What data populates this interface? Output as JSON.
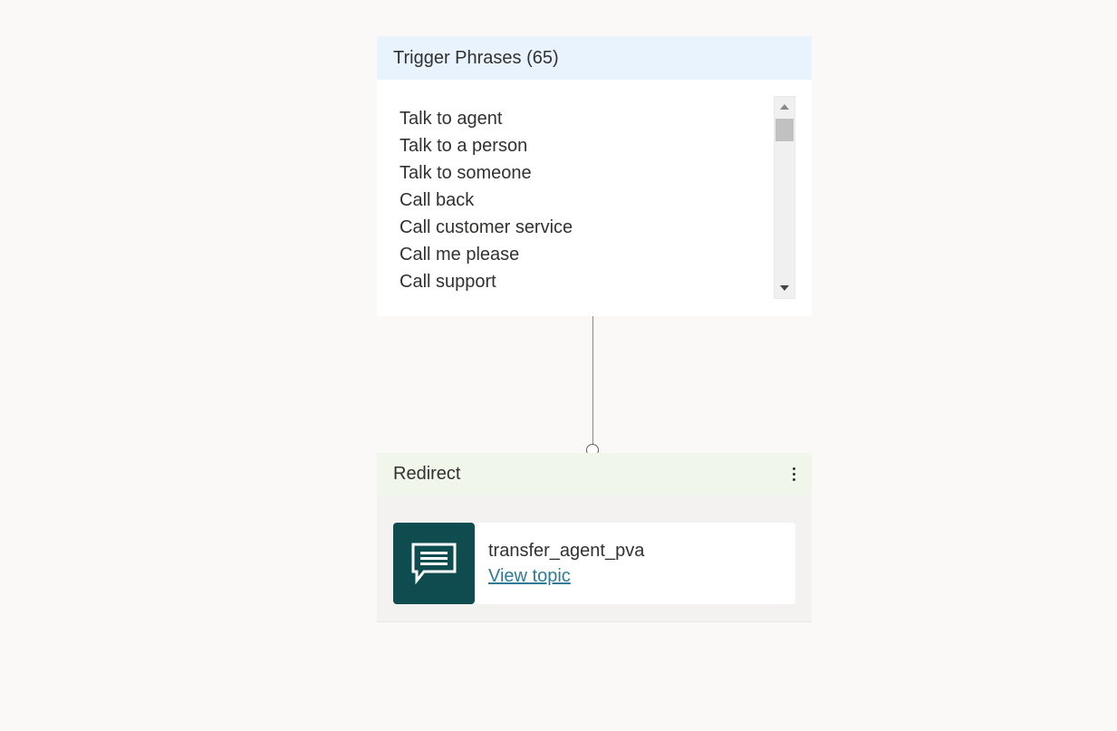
{
  "trigger": {
    "title": "Trigger Phrases (65)",
    "phrases": [
      "Talk to agent",
      "Talk to a person",
      "Talk to someone",
      "Call back",
      "Call customer service",
      "Call me please",
      "Call support"
    ]
  },
  "redirect": {
    "title": "Redirect",
    "topic_icon": "chat-message-icon",
    "topic_name": "transfer_agent_pva",
    "topic_link": "View topic"
  },
  "colors": {
    "trigger_header_bg": "#e8f3fd",
    "redirect_header_bg": "#f0f6ea",
    "topic_icon_bg": "#0f4c4f",
    "link": "#2f7a94"
  }
}
